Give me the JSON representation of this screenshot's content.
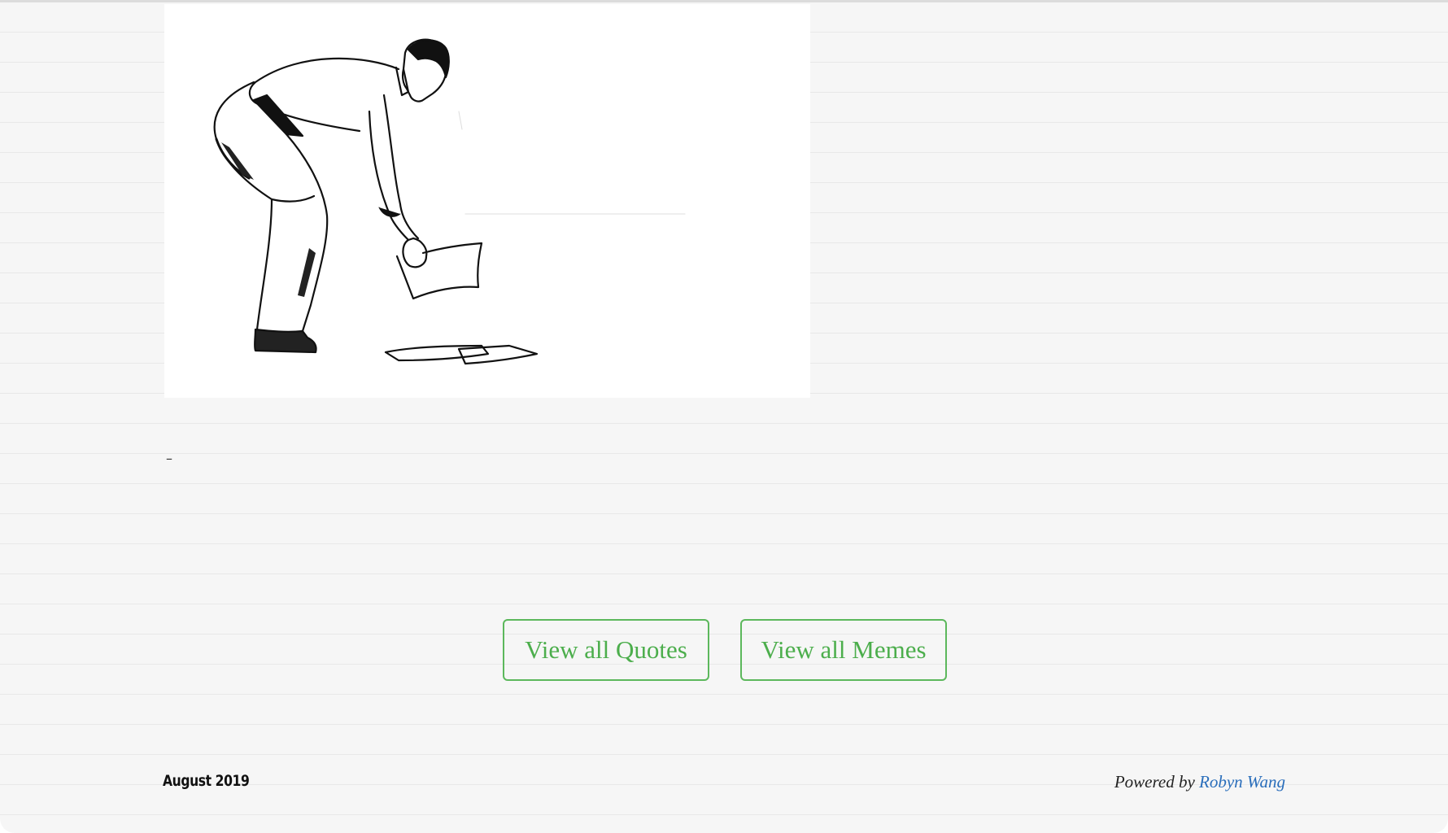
{
  "illustration": {
    "subject": "man-bending-to-pick-up-papers"
  },
  "content": {
    "dash_text": "–"
  },
  "buttons": {
    "quotes_label": "View all Quotes",
    "memes_label": "View all Memes"
  },
  "footer": {
    "date": "August 2019",
    "powered_by": "Powered by",
    "author": "Robyn Wang"
  },
  "colors": {
    "button_border": "#5cb85c",
    "button_text": "#4cae4c",
    "link": "#2a6ebb",
    "page_background": "#f6f6f6"
  }
}
